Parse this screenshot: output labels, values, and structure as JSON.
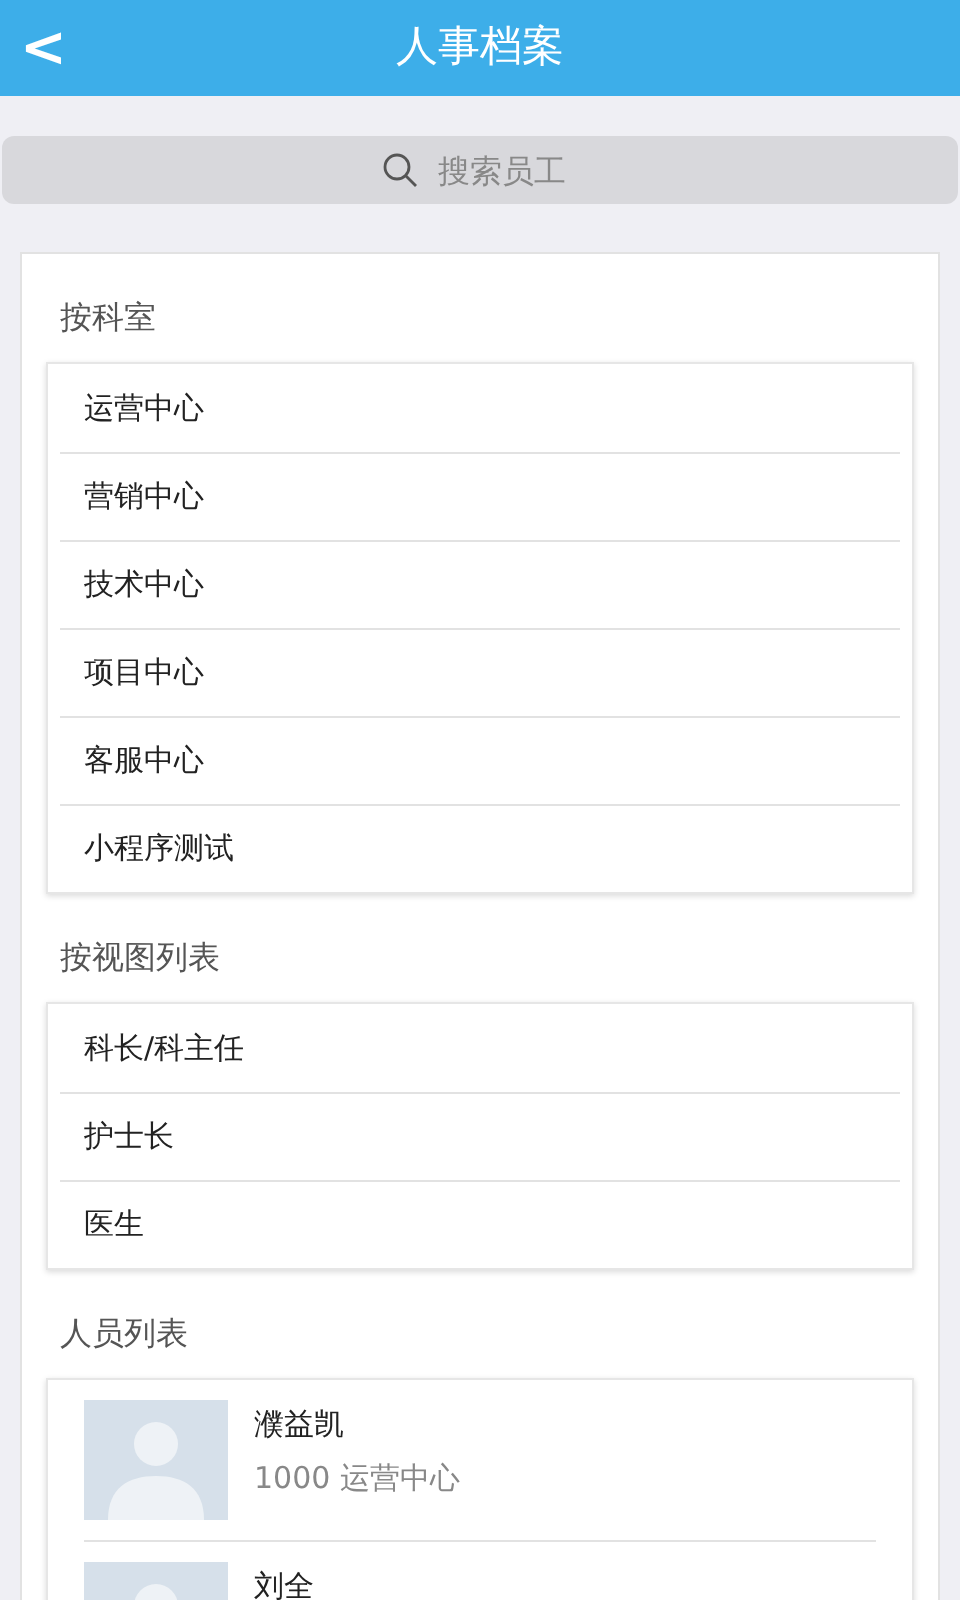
{
  "header": {
    "back": "<",
    "title": "人事档案"
  },
  "search": {
    "placeholder": "搜索员工"
  },
  "sections": [
    {
      "kind": "list",
      "title": "按科室",
      "items": [
        "运营中心",
        "营销中心",
        "技术中心",
        "项目中心",
        "客服中心",
        "小程序测试"
      ]
    },
    {
      "kind": "list",
      "title": "按视图列表",
      "items": [
        "科长/科主任",
        "护士长",
        "医生"
      ]
    },
    {
      "kind": "people",
      "title": "人员列表",
      "people": [
        {
          "name": "濮益凯",
          "detail": "1000 运营中心"
        },
        {
          "name": "刘全"
        }
      ]
    }
  ]
}
